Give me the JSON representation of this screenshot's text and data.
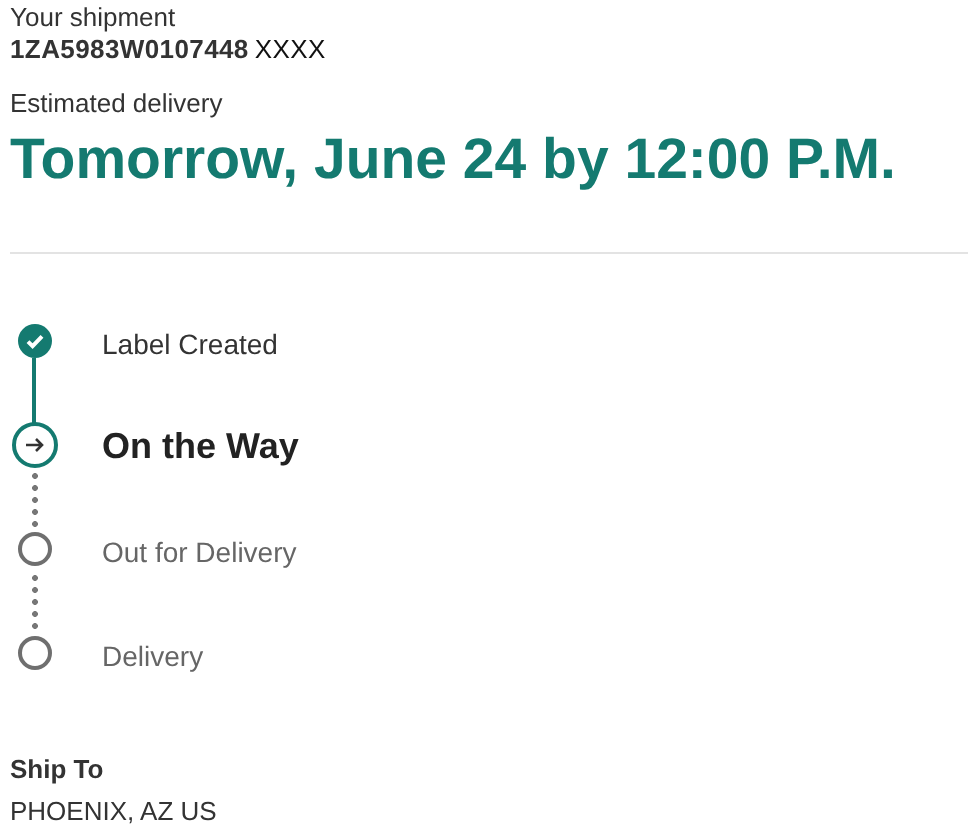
{
  "shipment": {
    "label": "Your shipment",
    "tracking_number": "1ZA5983W0107448",
    "tracking_suffix": "XXXX",
    "delivery_label": "Estimated delivery",
    "delivery_date": "Tomorrow, June 24 by 12:00 P.M."
  },
  "steps": [
    {
      "label": "Label Created",
      "kind": "done"
    },
    {
      "label": "On the Way",
      "kind": "current"
    },
    {
      "label": "Out for Delivery",
      "kind": "pending"
    },
    {
      "label": "Delivery",
      "kind": "pending"
    }
  ],
  "ship_to": {
    "label": "Ship To",
    "address": "PHOENIX, AZ US"
  }
}
